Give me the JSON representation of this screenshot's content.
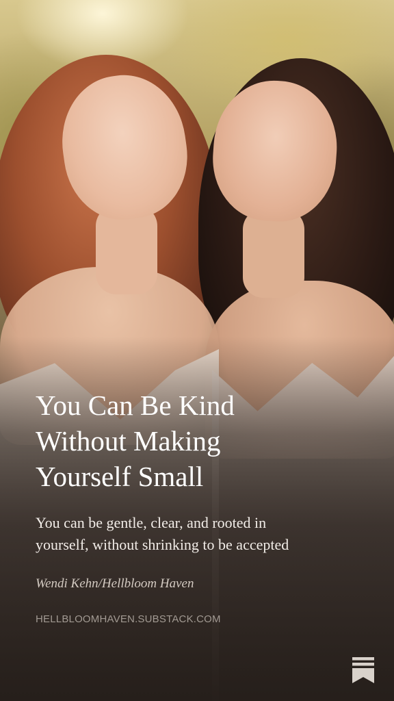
{
  "post": {
    "title_line1": "You Can Be Kind",
    "title_line2": "Without Making",
    "title_line3": "Yourself Small",
    "subtitle_line1": "You can be gentle, clear, and rooted in",
    "subtitle_line2": "yourself, without shrinking to be accepted",
    "author": "Wendi Kehn/Hellbloom Haven",
    "url": "HELLBLOOMHAVEN.SUBSTACK.COM"
  },
  "branding": {
    "logo_icon": "substack-bookmark-icon",
    "logo_color": "#d9d2cb"
  },
  "colors": {
    "title": "#ffffff",
    "subtitle": "#f2ede8",
    "author": "#d4cbc2",
    "url": "#a29a93"
  }
}
